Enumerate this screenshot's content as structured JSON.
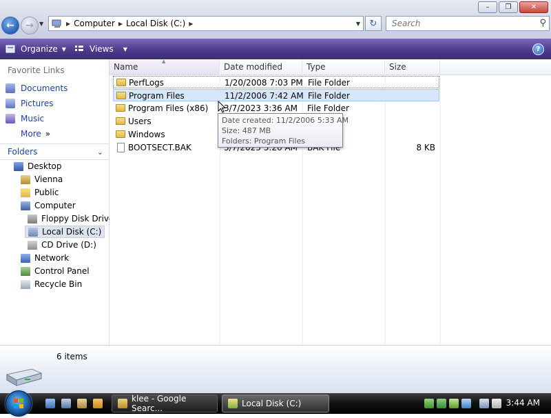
{
  "window": {
    "buttons": {
      "minimize": "–",
      "maximize": "❐",
      "close": "✕"
    }
  },
  "address": {
    "breadcrumbs": [
      "Computer",
      "Local Disk (C:)"
    ],
    "search_placeholder": "Search"
  },
  "toolbar": {
    "organize_label": "Organize",
    "views_label": "Views",
    "help_label": "?"
  },
  "nav": {
    "favorites_header": "Favorite Links",
    "favorites": [
      {
        "label": "Documents",
        "icon": "documents-icon"
      },
      {
        "label": "Pictures",
        "icon": "pictures-icon"
      },
      {
        "label": "Music",
        "icon": "music-icon"
      },
      {
        "label": "More",
        "icon": "more-chevron-icon",
        "suffix": "»"
      }
    ],
    "folders_label": "Folders",
    "tree": [
      {
        "label": "Desktop",
        "icon": "desktop-icon",
        "level": 0
      },
      {
        "label": "Vienna",
        "icon": "user-folder-icon",
        "level": 1
      },
      {
        "label": "Public",
        "icon": "folder-icon",
        "level": 1
      },
      {
        "label": "Computer",
        "icon": "computer-icon",
        "level": 1
      },
      {
        "label": "Floppy Disk Drive",
        "icon": "floppy-drive-icon",
        "level": 2
      },
      {
        "label": "Local Disk (C:)",
        "icon": "local-disk-icon",
        "level": 2,
        "selected": true
      },
      {
        "label": "CD Drive (D:)",
        "icon": "cd-drive-icon",
        "level": 2
      },
      {
        "label": "Network",
        "icon": "network-icon",
        "level": 1
      },
      {
        "label": "Control Panel",
        "icon": "control-panel-icon",
        "level": 1
      },
      {
        "label": "Recycle Bin",
        "icon": "recycle-bin-icon",
        "level": 1
      }
    ]
  },
  "columns": {
    "name": "Name",
    "date": "Date modified",
    "type": "Type",
    "size": "Size"
  },
  "files": [
    {
      "name": "PerfLogs",
      "date": "1/20/2008 7:03 PM",
      "type": "File Folder",
      "size": "",
      "kind": "folder"
    },
    {
      "name": "Program Files",
      "date": "11/2/2006 7:42 AM",
      "type": "File Folder",
      "size": "",
      "kind": "folder"
    },
    {
      "name": "Program Files (x86)",
      "date": "3/7/2023 3:36 AM",
      "type": "File Folder",
      "size": "",
      "kind": "folder"
    },
    {
      "name": "Users",
      "date": "",
      "type": "",
      "size": "",
      "kind": "folder"
    },
    {
      "name": "Windows",
      "date": "",
      "type": "",
      "size": "",
      "kind": "folder"
    },
    {
      "name": "BOOTSECT.BAK",
      "date": "3/7/2023 3:26 AM",
      "type": "BAK File",
      "size": "8 KB",
      "kind": "file"
    }
  ],
  "tooltip": {
    "line1": "Date created: 11/2/2006 5:33 AM",
    "line2": "Size: 487 MB",
    "line3": "Folders: Program Files"
  },
  "details": {
    "item_count": "6 items"
  },
  "taskbar": {
    "tasks": [
      {
        "label": "klee - Google Searc...",
        "icon": "browser-icon"
      },
      {
        "label": "Local Disk (C:)",
        "icon": "explorer-icon",
        "active": true
      }
    ],
    "clock": "3:44 AM"
  },
  "colors": {
    "toolbar": "#4d3b8e",
    "link": "#1a3fb4",
    "hover_row": "#d8e6fa"
  }
}
